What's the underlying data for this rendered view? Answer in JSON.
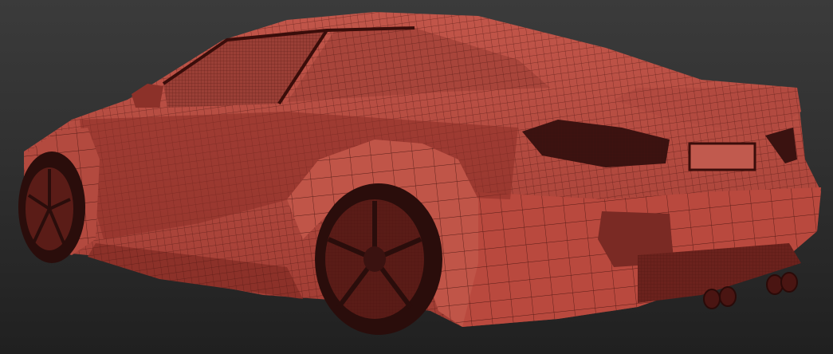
{
  "scene": {
    "subject": "car-wireframe-render",
    "colors": {
      "background_top": "#3b3b3b",
      "background_bottom": "#202020",
      "body": "#b5473c",
      "body_shadow": "#7a2a24",
      "wire": "#4a1410",
      "glass": "#8e3a32",
      "tire": "#2a0d0b"
    },
    "parts": [
      "body",
      "rear-window",
      "side-window",
      "spoiler",
      "rear-wheel",
      "front-wheel",
      "tail-lights",
      "license-plate",
      "exhaust-tips",
      "diffuser"
    ]
  }
}
